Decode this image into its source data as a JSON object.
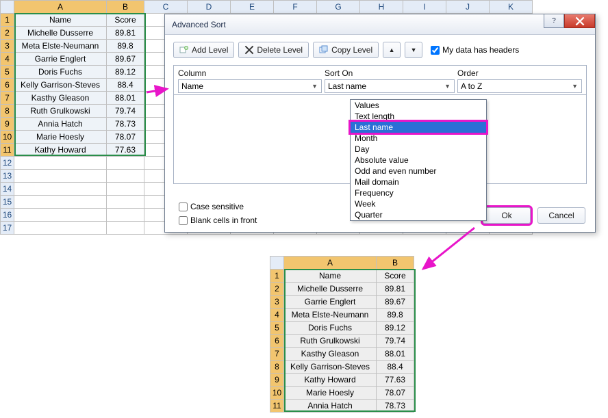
{
  "sheet1": {
    "cols": [
      "A",
      "B",
      "C",
      "D",
      "E",
      "F",
      "G",
      "H",
      "I",
      "J",
      "K"
    ],
    "col_widths": [
      "colA",
      "colB",
      "colC",
      "colC",
      "colC",
      "colC",
      "colC",
      "colC",
      "colC",
      "colC",
      "colC"
    ],
    "headers": [
      "Name",
      "Score"
    ],
    "rows": [
      {
        "r": "1"
      },
      {
        "r": "2",
        "name": "Michelle Dusserre",
        "score": "89.81"
      },
      {
        "r": "3",
        "name": "Meta Elste-Neumann",
        "score": "89.8"
      },
      {
        "r": "4",
        "name": "Garrie Englert",
        "score": "89.67"
      },
      {
        "r": "5",
        "name": "Doris Fuchs",
        "score": "89.12"
      },
      {
        "r": "6",
        "name": "Kelly Garrison-Steves",
        "score": "88.4"
      },
      {
        "r": "7",
        "name": "Kasthy Gleason",
        "score": "88.01"
      },
      {
        "r": "8",
        "name": "Ruth Grulkowski",
        "score": "79.74"
      },
      {
        "r": "9",
        "name": "Annia Hatch",
        "score": "78.73"
      },
      {
        "r": "10",
        "name": "Marie Hoesly",
        "score": "78.07"
      },
      {
        "r": "11",
        "name": "Kathy Howard",
        "score": "77.63"
      },
      {
        "r": "12"
      },
      {
        "r": "13"
      },
      {
        "r": "14"
      },
      {
        "r": "15"
      },
      {
        "r": "16"
      },
      {
        "r": "17"
      }
    ]
  },
  "sheet2": {
    "cols": [
      "A",
      "B"
    ],
    "headers": [
      "Name",
      "Score"
    ],
    "rows": [
      {
        "r": "1"
      },
      {
        "r": "2",
        "name": "Michelle Dusserre",
        "score": "89.81"
      },
      {
        "r": "3",
        "name": "Garrie Englert",
        "score": "89.67"
      },
      {
        "r": "4",
        "name": "Meta Elste-Neumann",
        "score": "89.8"
      },
      {
        "r": "5",
        "name": "Doris Fuchs",
        "score": "89.12"
      },
      {
        "r": "6",
        "name": "Ruth Grulkowski",
        "score": "79.74"
      },
      {
        "r": "7",
        "name": "Kasthy Gleason",
        "score": "88.01"
      },
      {
        "r": "8",
        "name": "Kelly Garrison-Steves",
        "score": "88.4"
      },
      {
        "r": "9",
        "name": "Kathy Howard",
        "score": "77.63"
      },
      {
        "r": "10",
        "name": "Marie Hoesly",
        "score": "78.07"
      },
      {
        "r": "11",
        "name": "Annia Hatch",
        "score": "78.73"
      }
    ]
  },
  "dialog": {
    "title": "Advanced Sort",
    "add_level": "Add Level",
    "delete_level": "Delete Level",
    "copy_level": "Copy Level",
    "headers_chk": "My data has headers",
    "grid": {
      "col1": "Column",
      "col2": "Sort On",
      "col3": "Order"
    },
    "row": {
      "column": "Name",
      "sorton": "Last name",
      "order": "A to Z"
    },
    "options": [
      "Values",
      "Text length",
      "Last name",
      "Month",
      "Day",
      "Absolute value",
      "Odd and even number",
      "Mail domain",
      "Frequency",
      "Week",
      "Quarter"
    ],
    "selected_option": 2,
    "case_sensitive": "Case sensitive",
    "blank_front": "Blank cells in front",
    "ok": "Ok",
    "cancel": "Cancel"
  }
}
